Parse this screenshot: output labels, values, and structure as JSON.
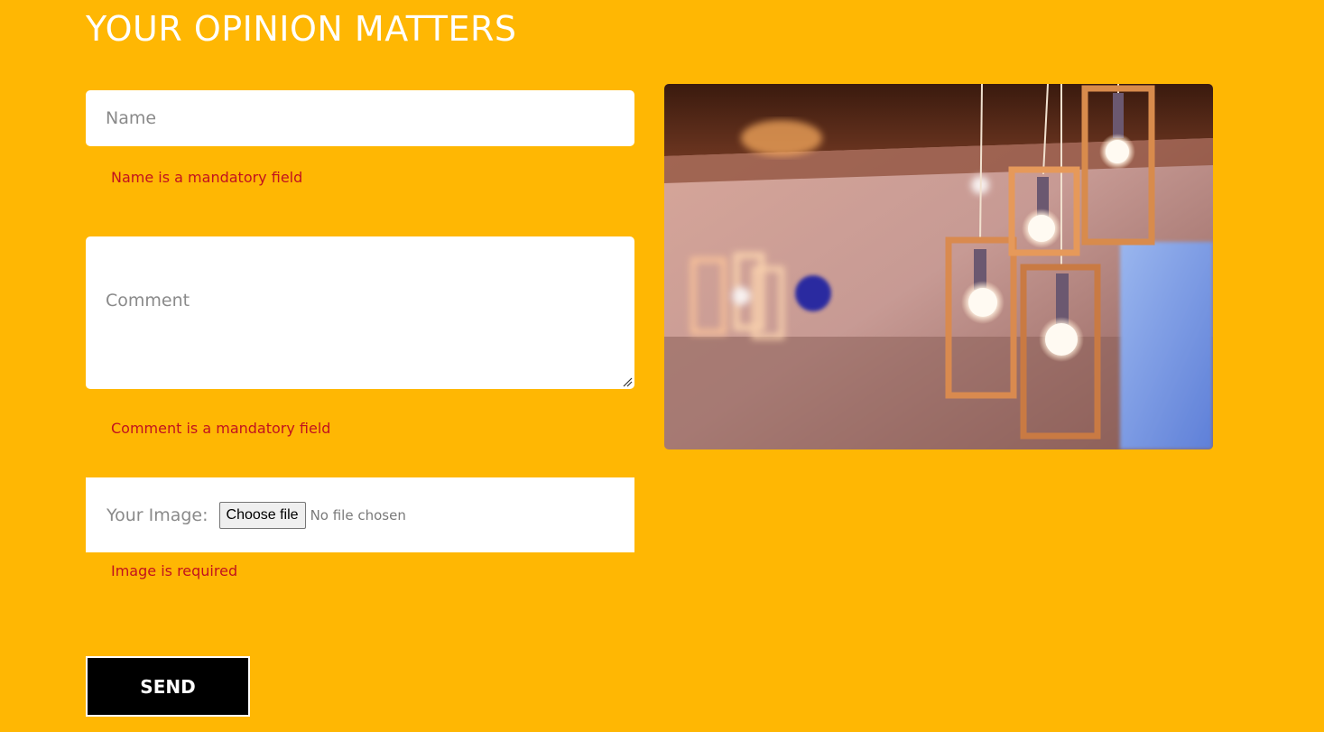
{
  "form": {
    "title": "YOUR OPINION MATTERS",
    "name": {
      "placeholder": "Name",
      "value": "",
      "error": "Name is a mandatory field"
    },
    "comment": {
      "placeholder": "Comment",
      "value": "",
      "error": "Comment is a mandatory field"
    },
    "image": {
      "label": "Your Image:",
      "button_label": "Choose file",
      "status": "No file chosen",
      "error": "Image is required"
    },
    "send_label": "SEND"
  },
  "colors": {
    "background": "#FFB703",
    "error": "#C1121F",
    "button": "#000000"
  }
}
